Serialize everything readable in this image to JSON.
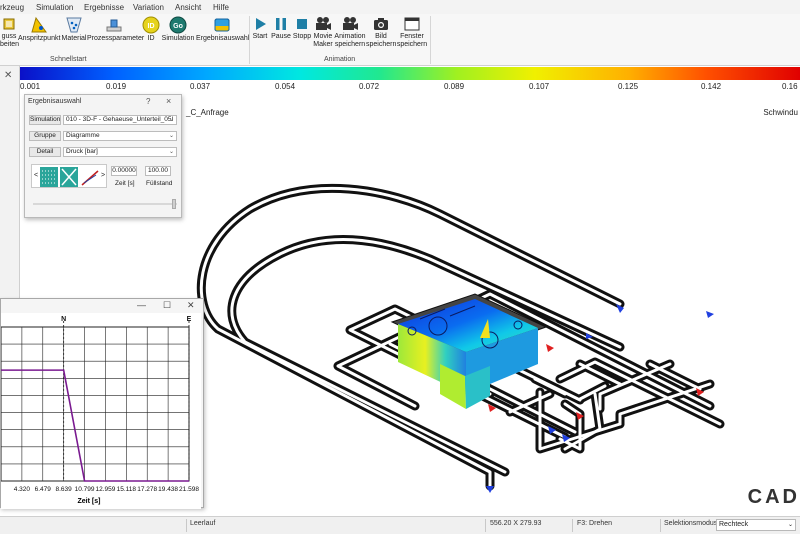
{
  "menu": {
    "items": [
      "rkzeug",
      "Simulation",
      "Ergebnisse",
      "Variation",
      "Ansicht",
      "Hilfe"
    ]
  },
  "ribbon": {
    "buttons_left": [
      {
        "label": "guss",
        "label2": "beiten",
        "icon": "gate-edit-icon"
      },
      {
        "label": "Anspritzpunkt",
        "label2": "",
        "icon": "injection-point-icon"
      },
      {
        "label": "Material",
        "label2": "",
        "icon": "material-icon"
      },
      {
        "label": "Prozessparameter",
        "label2": "",
        "icon": "process-parameter-icon"
      },
      {
        "label": "ID",
        "label2": "",
        "icon": "id-icon"
      },
      {
        "label": "Simulation",
        "label2": "",
        "icon": "simulation-go-icon"
      },
      {
        "label": "Ergebnisauswahl",
        "label2": "",
        "icon": "result-selection-icon"
      }
    ],
    "group_left": "Schnellstart",
    "buttons_right": [
      {
        "label": "Start",
        "label2": "",
        "icon": "play-icon"
      },
      {
        "label": "Pause",
        "label2": "",
        "icon": "pause-icon"
      },
      {
        "label": "Stopp",
        "label2": "",
        "icon": "stop-icon"
      },
      {
        "label": "Movie",
        "label2": "Maker",
        "icon": "movie-camera-icon"
      },
      {
        "label": "Animation",
        "label2": "speichern",
        "icon": "animation-camera-icon"
      },
      {
        "label": "Bild",
        "label2": "speichern",
        "icon": "photo-camera-icon"
      },
      {
        "label": "Fenster",
        "label2": "speichern",
        "icon": "window-icon"
      }
    ],
    "group_right": "Animation"
  },
  "scale": {
    "ticks": [
      "0.001",
      "0.019",
      "0.037",
      "0.054",
      "0.072",
      "0.089",
      "0.107",
      "0.125",
      "0.142",
      "0.16"
    ]
  },
  "viewport": {
    "title_fragment": "_C_Anfrage",
    "right_label": "Schwindu",
    "logo_text": "CAD"
  },
  "dialog": {
    "title": "Ergebnisauswahl",
    "help": "?",
    "close": "×",
    "rows": [
      {
        "button": "Simulation",
        "value": "010 - 3D-F - Gehaeuse_Unterteil_05I"
      },
      {
        "button": "Gruppe",
        "value": "Diagramme"
      },
      {
        "button": "Detail",
        "value": "Druck [bar]"
      }
    ],
    "time_value": "0.00000",
    "fill_value": "100.00",
    "time_label": "Zeit [s]",
    "fill_label": "Füllstand",
    "prev": "<",
    "next": ">"
  },
  "graph": {
    "controls": [
      "—",
      "☐",
      "✕"
    ],
    "markers": [
      {
        "label": "N",
        "x": 8.639
      },
      {
        "label": "E",
        "x": 21.598
      }
    ],
    "chart_data": {
      "type": "line",
      "xlabel": "Zeit [s]",
      "xticks": [
        "4.320",
        "6.479",
        "8.639",
        "10.799",
        "12.959",
        "15.118",
        "17.278",
        "19.438",
        "21.598"
      ],
      "x": [
        0,
        8.639,
        10.799,
        21.598
      ],
      "values": [
        0.72,
        0.72,
        0.0,
        0.0
      ],
      "xlim": [
        2.16,
        21.598
      ],
      "ylim": [
        0,
        1
      ],
      "grid": true
    }
  },
  "status": {
    "left": "Leerlauf",
    "coords": "556.20 X 279.93",
    "hint": "F3: Drehen",
    "mode_label": "Selektionsmodus",
    "mode_value": "Rechteck"
  }
}
